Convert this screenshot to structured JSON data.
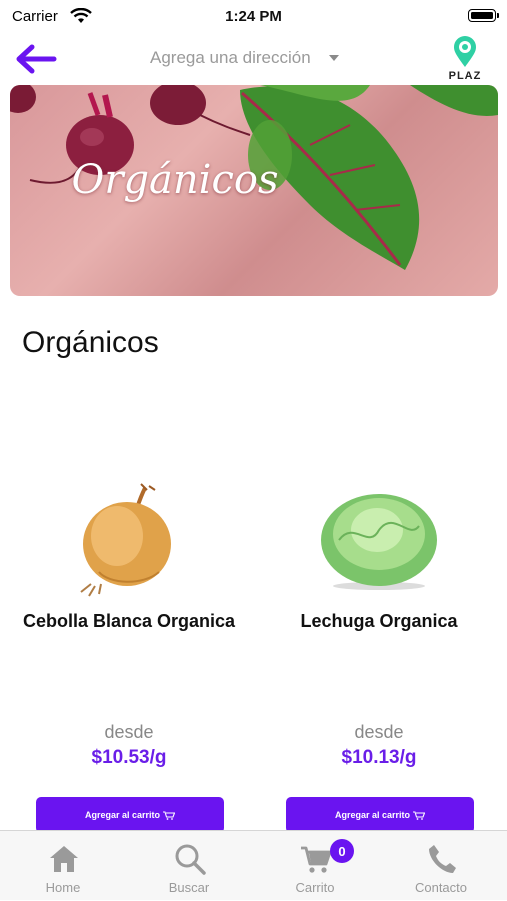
{
  "status_bar": {
    "carrier": "Carrier",
    "time": "1:24 PM"
  },
  "nav": {
    "address_label": "Agrega una dirección",
    "logo_text": "PLAZ"
  },
  "banner": {
    "title": "Orgánicos"
  },
  "section": {
    "title": "Orgánicos"
  },
  "products": [
    {
      "name": "Cebolla Blanca Organica",
      "desde": "desde",
      "price": "$10.53/g",
      "button_label": "Agregar al carrito"
    },
    {
      "name": "Lechuga Organica",
      "desde": "desde",
      "price": "$10.13/g",
      "button_label": "Agregar al carrito"
    }
  ],
  "tabs": [
    {
      "label": "Home",
      "icon": "home-icon"
    },
    {
      "label": "Buscar",
      "icon": "search-icon"
    },
    {
      "label": "Carrito",
      "icon": "cart-icon",
      "badge": "0"
    },
    {
      "label": "Contacto",
      "icon": "phone-icon"
    }
  ],
  "colors": {
    "accent": "#6a14f0",
    "price": "#6a1ee8",
    "muted": "#9a9a9a"
  }
}
